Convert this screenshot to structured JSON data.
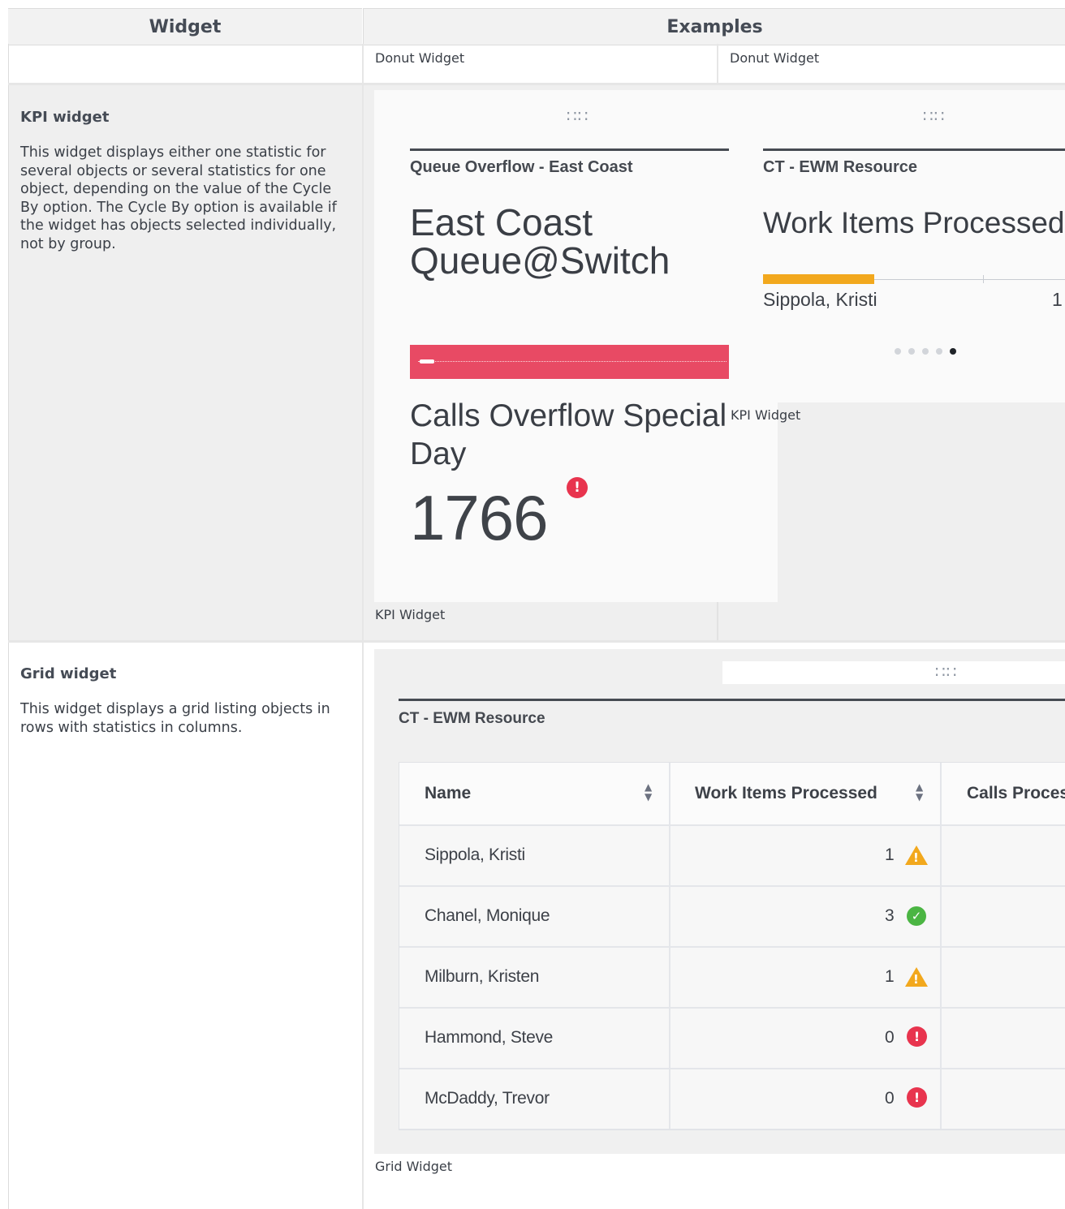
{
  "table": {
    "headers": [
      "Widget",
      "Examples"
    ],
    "donut_captions": [
      "Donut Widget",
      "Donut Widget"
    ]
  },
  "kpi_row": {
    "title": "KPI widget",
    "description": "This widget displays either one statistic for several objects or several statistics for one object, depending on the value of the Cycle By option. The Cycle By option is available if the widget has objects selected individually, not by group.",
    "card1": {
      "header": "Queue Overflow - East Coast",
      "object_name": "East Coast Queue@Switch",
      "stat_name": "Calls Overflow Special Day",
      "value": "1766",
      "caption": "KPI Widget",
      "bar_color": "#e84a64"
    },
    "card2": {
      "header": "CT - EWM Resource",
      "stat_name": "Work Items Processed",
      "bar_label": "Sippola, Kristi",
      "bar_value": "1",
      "bar_fraction": 0.3,
      "bar_color": "#f2a81d",
      "pager_count": 5,
      "pager_active": 5,
      "caption": "KPI Widget"
    }
  },
  "grid_row": {
    "title": "Grid widget",
    "description": "This widget displays a grid listing objects in rows with statistics in columns.",
    "card": {
      "header": "CT - EWM Resource",
      "columns": [
        "Name",
        "Work Items Processed",
        "Calls Proces"
      ],
      "rows": [
        {
          "name": "Sippola, Kristi",
          "value": "1",
          "status": "warning"
        },
        {
          "name": "Chanel, Monique",
          "value": "3",
          "status": "ok"
        },
        {
          "name": "Milburn, Kristen",
          "value": "1",
          "status": "warning"
        },
        {
          "name": "Hammond, Steve",
          "value": "0",
          "status": "error"
        },
        {
          "name": "McDaddy, Trevor",
          "value": "0",
          "status": "error"
        }
      ],
      "status_colors": {
        "warning": "#f2a81d",
        "ok": "#4bb543",
        "error": "#e8344e"
      },
      "caption": "Grid Widget"
    }
  }
}
